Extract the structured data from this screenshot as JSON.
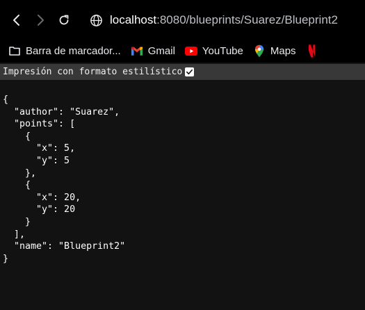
{
  "browser": {
    "url_host": "localhost",
    "url_rest": ":8080/blueprints/Suarez/Blueprint2"
  },
  "bookmarks": [
    {
      "label": "Barra de marcador...",
      "icon": "folder-icon"
    },
    {
      "label": "Gmail",
      "icon": "gmail-icon"
    },
    {
      "label": "YouTube",
      "icon": "youtube-icon"
    },
    {
      "label": "Maps",
      "icon": "maps-icon"
    },
    {
      "label": "",
      "icon": "netflix-icon"
    }
  ],
  "pretty_print": {
    "label": "Impresión con formato estilístico",
    "checked": true
  },
  "json_lines": [
    "{",
    "  \"author\": \"Suarez\",",
    "  \"points\": [",
    "    {",
    "      \"x\": 5,",
    "      \"y\": 5",
    "    },",
    "    {",
    "      \"x\": 20,",
    "      \"y\": 20",
    "    }",
    "  ],",
    "  \"name\": \"Blueprint2\"",
    "}"
  ]
}
